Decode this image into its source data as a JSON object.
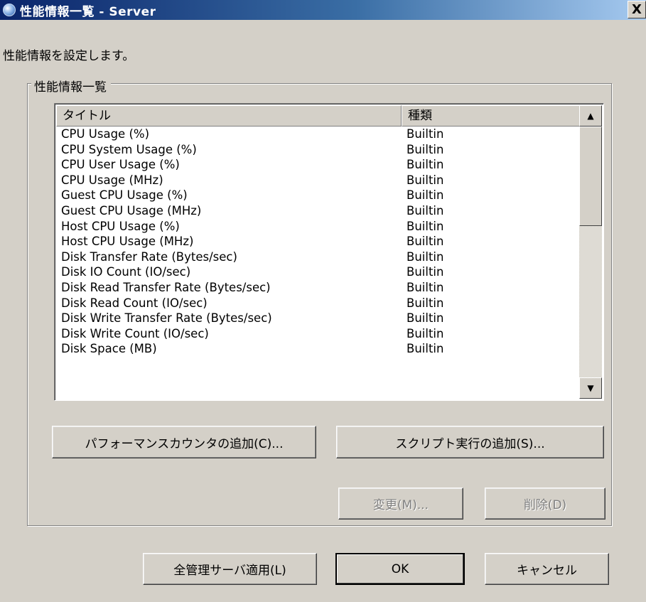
{
  "window": {
    "title": "性能情報一覧 - Server",
    "close_label": "X"
  },
  "description": "性能情報を設定します。",
  "group": {
    "label": "性能情報一覧"
  },
  "list": {
    "columns": [
      "タイトル",
      "種類"
    ],
    "rows": [
      [
        "CPU Usage (%)",
        "Builtin"
      ],
      [
        "CPU System Usage (%)",
        "Builtin"
      ],
      [
        "CPU User Usage (%)",
        "Builtin"
      ],
      [
        "CPU Usage (MHz)",
        "Builtin"
      ],
      [
        "Guest CPU Usage (%)",
        "Builtin"
      ],
      [
        "Guest CPU Usage (MHz)",
        "Builtin"
      ],
      [
        "Host CPU Usage (%)",
        "Builtin"
      ],
      [
        "Host CPU Usage (MHz)",
        "Builtin"
      ],
      [
        "Disk Transfer Rate (Bytes/sec)",
        "Builtin"
      ],
      [
        "Disk IO Count (IO/sec)",
        "Builtin"
      ],
      [
        "Disk Read Transfer Rate (Bytes/sec)",
        "Builtin"
      ],
      [
        "Disk Read Count (IO/sec)",
        "Builtin"
      ],
      [
        "Disk Write Transfer Rate (Bytes/sec)",
        "Builtin"
      ],
      [
        "Disk Write Count (IO/sec)",
        "Builtin"
      ],
      [
        "Disk Space (MB)",
        "Builtin"
      ]
    ],
    "scroll_up_glyph": "▲",
    "scroll_down_glyph": "▼"
  },
  "buttons": {
    "add_perf_counter": "パフォーマンスカウンタの追加(C)...",
    "add_script": "スクリプト実行の追加(S)...",
    "modify": "変更(M)...",
    "delete": "削除(D)",
    "apply_all": "全管理サーバ適用(L)",
    "ok": "OK",
    "cancel": "キャンセル"
  }
}
